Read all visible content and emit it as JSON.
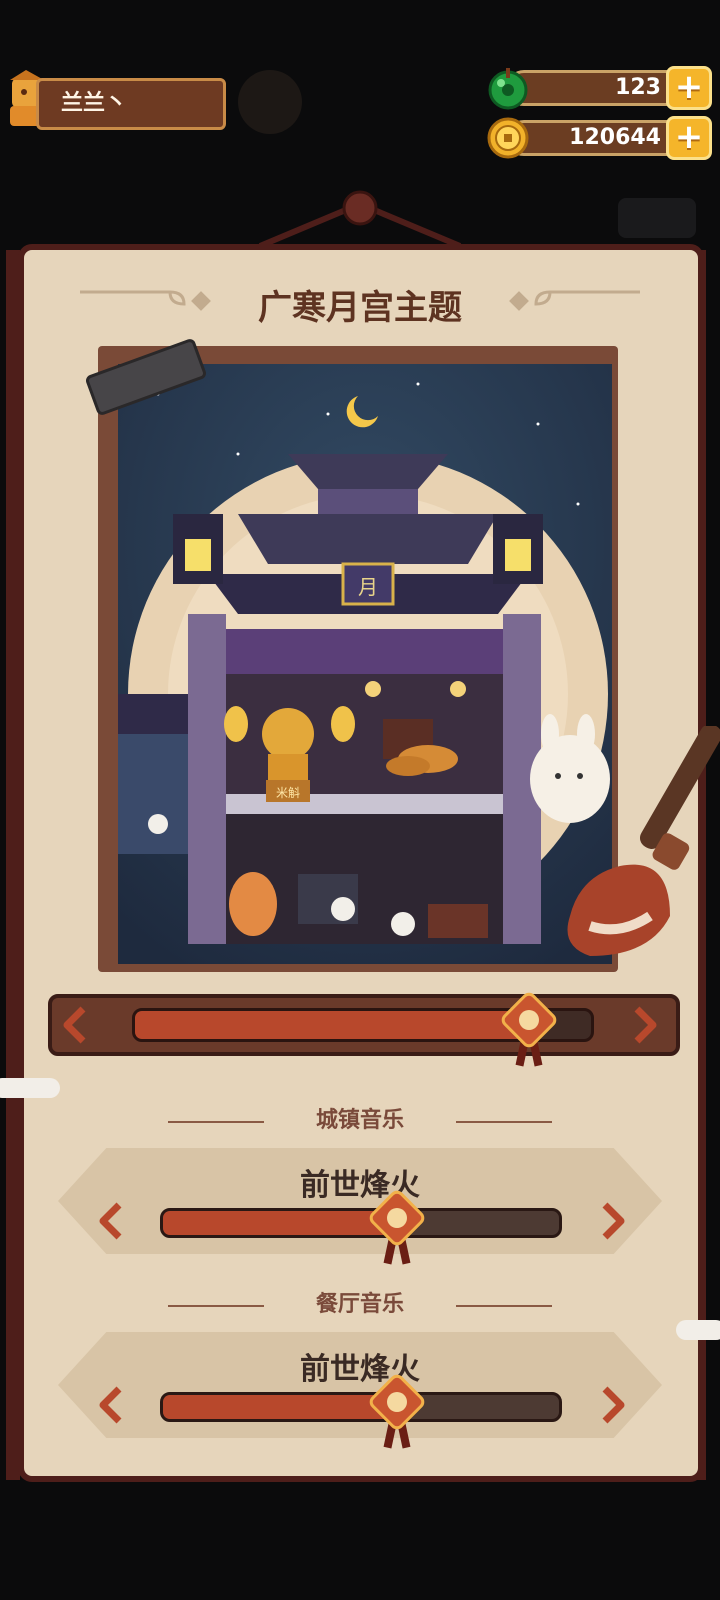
{
  "player": {
    "name": "兰兰丶"
  },
  "currency": {
    "gems": "123",
    "coins": "120644"
  },
  "panel": {
    "title": "广寒月宫主题",
    "theme_progress": 0.86,
    "sign_text": "月",
    "shop_sign": "米斛"
  },
  "town_music": {
    "label": "城镇音乐",
    "song": "前世烽火",
    "progress": 0.59
  },
  "restaurant_music": {
    "label": "餐厅音乐",
    "song": "前世烽火",
    "progress": 0.59
  },
  "colors": {
    "accent_red": "#b8482c",
    "panel_bg": "#e6d5bb",
    "frame_dark": "#4e1e1a",
    "gold": "#f5b52a"
  }
}
